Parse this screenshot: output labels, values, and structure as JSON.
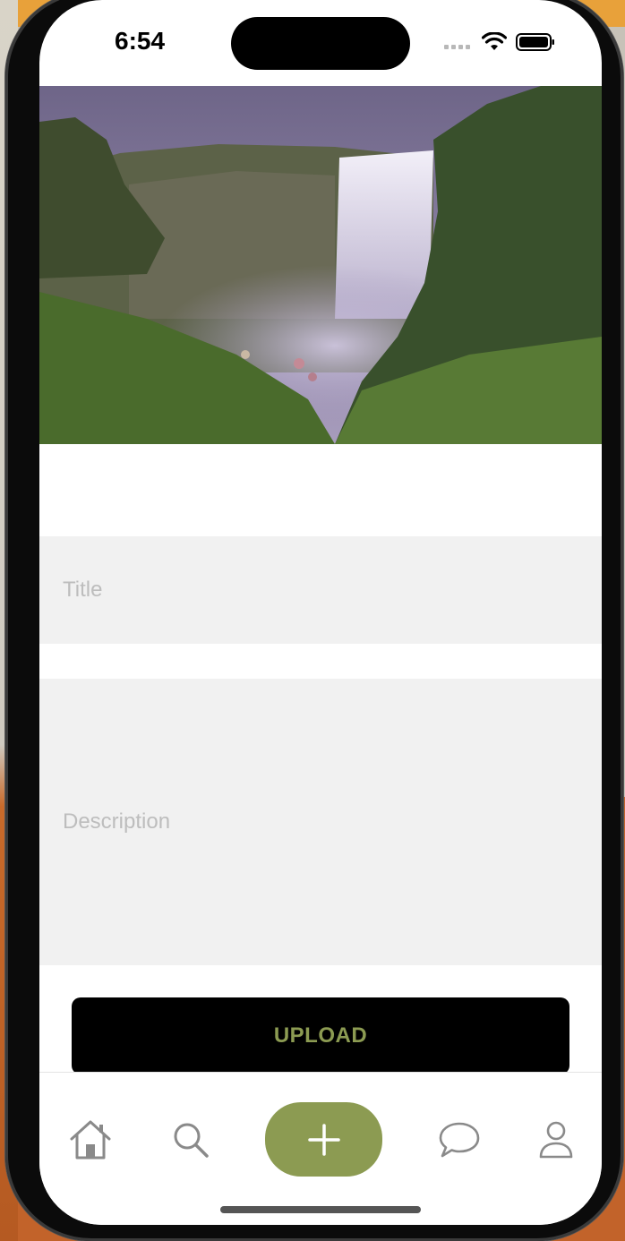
{
  "status_bar": {
    "time": "6:54"
  },
  "form": {
    "title_placeholder": "Title",
    "description_placeholder": "Description",
    "upload_label": "UPLOAD"
  },
  "tabs": [
    {
      "name": "home",
      "icon": "home-icon"
    },
    {
      "name": "search",
      "icon": "search-icon"
    },
    {
      "name": "add",
      "icon": "plus-icon"
    },
    {
      "name": "messages",
      "icon": "chat-bubble-icon"
    },
    {
      "name": "profile",
      "icon": "person-icon"
    }
  ],
  "colors": {
    "accent": "#8c9b52",
    "field_bg": "#f1f1f1",
    "placeholder": "#bdbdbd"
  }
}
